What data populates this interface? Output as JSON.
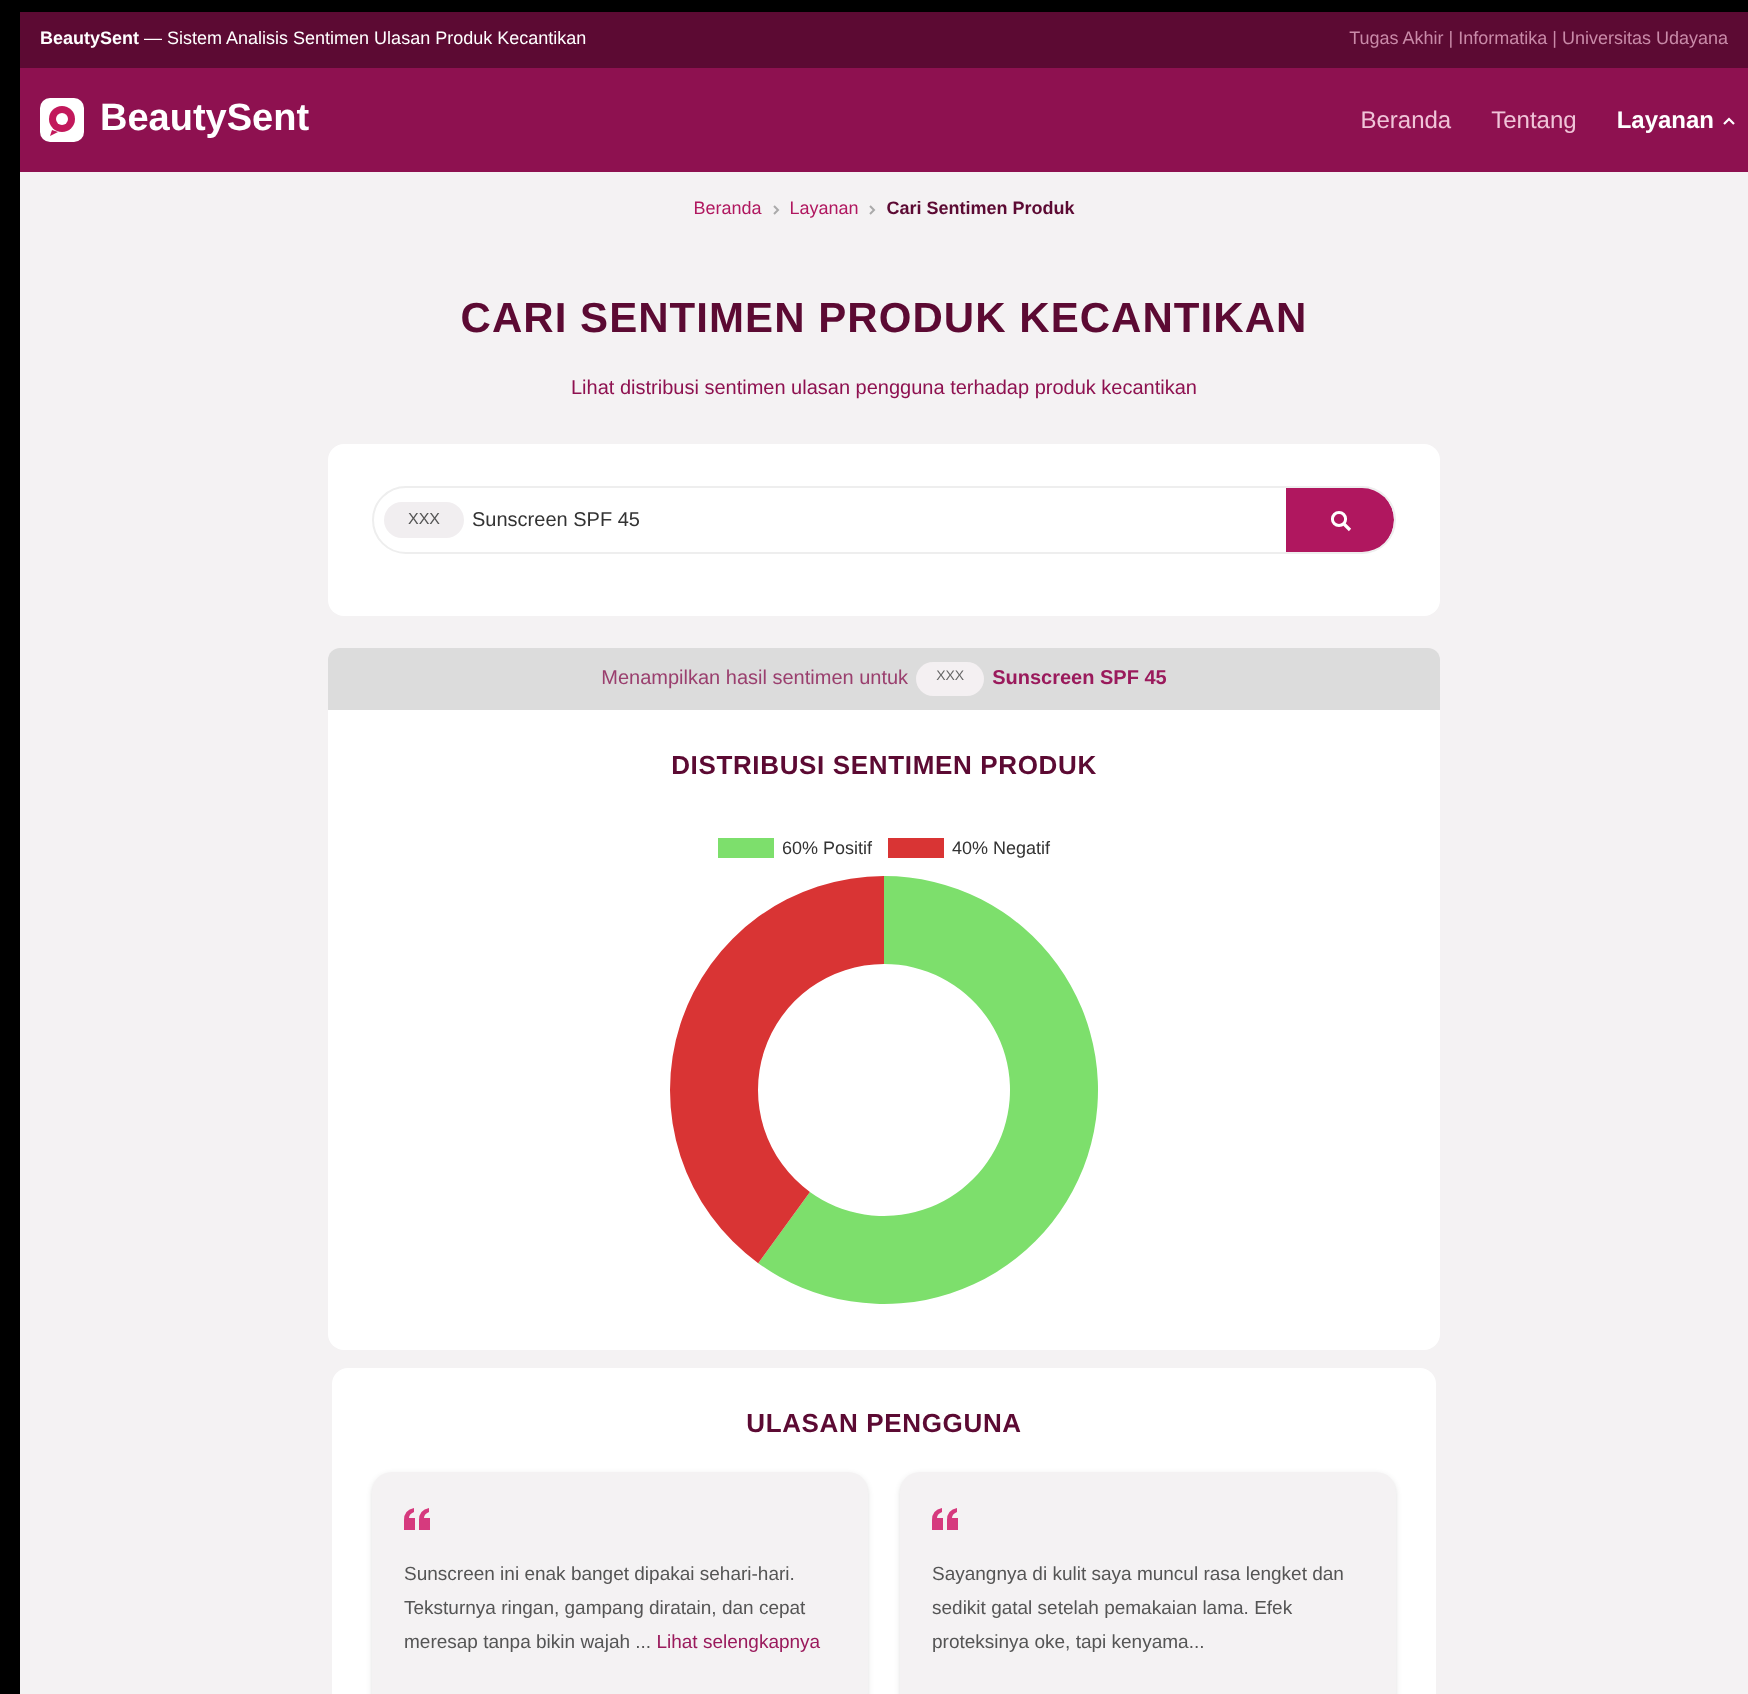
{
  "top_bar": {
    "brand": "BeautySent",
    "tagline": "— Sistem Analisis Sentimen Ulasan Produk Kecantikan",
    "right_text": "Tugas Akhir | Informatika | Universitas Udayana"
  },
  "navbar": {
    "logo": "BeautySent",
    "links": [
      {
        "label": "Beranda",
        "selected": false,
        "dropdown": false
      },
      {
        "label": "Tentang",
        "selected": false,
        "dropdown": false
      },
      {
        "label": "Layanan",
        "selected": true,
        "dropdown": true
      }
    ]
  },
  "breadcrumb": [
    {
      "label": "Beranda",
      "current": false
    },
    {
      "label": "Layanan",
      "current": false
    },
    {
      "label": "Cari Sentimen Produk",
      "current": true
    }
  ],
  "page_title": "CARI SENTIMEN PRODUK KECANTIKAN",
  "subtitle": "Lihat distribusi sentimen ulasan pengguna terhadap produk kecantikan",
  "search": {
    "chip": "XXX",
    "value": "Sunscreen SPF 45"
  },
  "result_banner": {
    "prefix": "Menampilkan hasil sentimen untuk",
    "chip": "XXX",
    "product": "Sunscreen SPF 45"
  },
  "chart_section": {
    "title": "DISTRIBUSI SENTIMEN PRODUK",
    "chart_data": {
      "type": "donut",
      "categories": [
        "60% Positif",
        "40% Negatif"
      ],
      "values": [
        60,
        40
      ],
      "colors": [
        "#7ddf6c",
        "#d93434"
      ]
    }
  },
  "reviews": {
    "title": "ULASAN PENGGUNA",
    "items": [
      {
        "text": "Sunscreen ini enak banget dipakai sehari-hari. Teksturnya ringan, gampang diratain, dan cepat meresap tanpa bikin wajah ...",
        "link": "Lihat selengkapnya"
      },
      {
        "text": "Sayangnya di kulit saya muncul rasa lengket dan sedikit gatal setelah pemakaian lama. Efek proteksinya oke, tapi kenyama..."
      }
    ]
  }
}
